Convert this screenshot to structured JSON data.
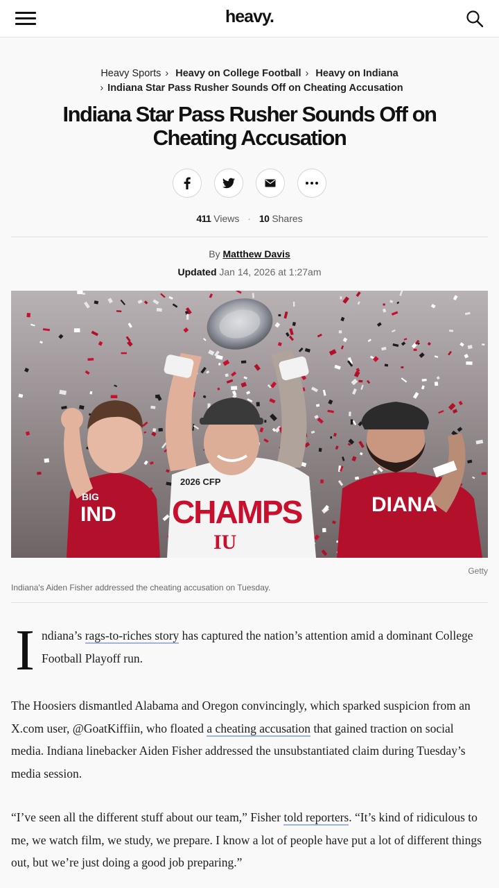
{
  "header": {
    "logo": "heavy.",
    "menu_icon": "hamburger-menu-icon",
    "search_icon": "search-icon"
  },
  "breadcrumb": [
    {
      "label": "Heavy Sports",
      "bold": false
    },
    {
      "label": "Heavy on College Football",
      "bold": true
    },
    {
      "label": "Heavy on Indiana",
      "bold": true
    },
    {
      "label": "Indiana Star Pass Rusher Sounds Off on Cheating Accusation",
      "bold": true
    }
  ],
  "article": {
    "headline": "Indiana Star Pass Rusher Sounds Off on Cheating Accusation",
    "share_icons": [
      "facebook-icon",
      "twitter-icon",
      "email-icon",
      "more-icon"
    ],
    "views_count": "411",
    "views_label": "Views",
    "shares_count": "10",
    "shares_label": "Shares",
    "by_label": "By",
    "author": "Matthew Davis",
    "updated_label": "Updated",
    "updated_date": "Jan 14, 2026 at 1:27am",
    "image_credit": "Getty",
    "image_caption": "Indiana's Aiden Fisher addressed the cheating accusation on Tuesday.",
    "image_text": {
      "shirt": "CHAMPS",
      "shirt_top": "2026 CFP",
      "shirt_logo": "IU",
      "left_jersey": "IND",
      "right_jersey": "DIANA",
      "left_jersey_brand": "BIG"
    },
    "p1": {
      "dropcap": "I",
      "before_link": "ndiana’s ",
      "link": "rags-to-riches story",
      "after_link": " has captured the nation’s attention amid a dominant College Football Playoff run."
    },
    "p2": {
      "before_link": "The Hoosiers dismantled Alabama and Oregon convincingly, which sparked suspicion from an X.com user, @GoatKiffiin, who floated ",
      "link": "a cheating accusation",
      "after_link": " that gained traction on social media. Indiana linebacker Aiden Fisher addressed the unsubstantiated claim during Tuesday’s media session."
    },
    "p3": {
      "before_link": "“I’ve seen all the different stuff about our team,” Fisher ",
      "link": "told reporters",
      "after_link": ". “It’s kind of ridiculous to me, we watch film, we study, we prepare. I know a lot of people have put a lot of different things out, but we’re just doing a good job preparing.”"
    }
  },
  "colors": {
    "background": "#f9f9f9",
    "link_underline": "#9fb4e0",
    "indiana_crimson": "#c8102e"
  }
}
